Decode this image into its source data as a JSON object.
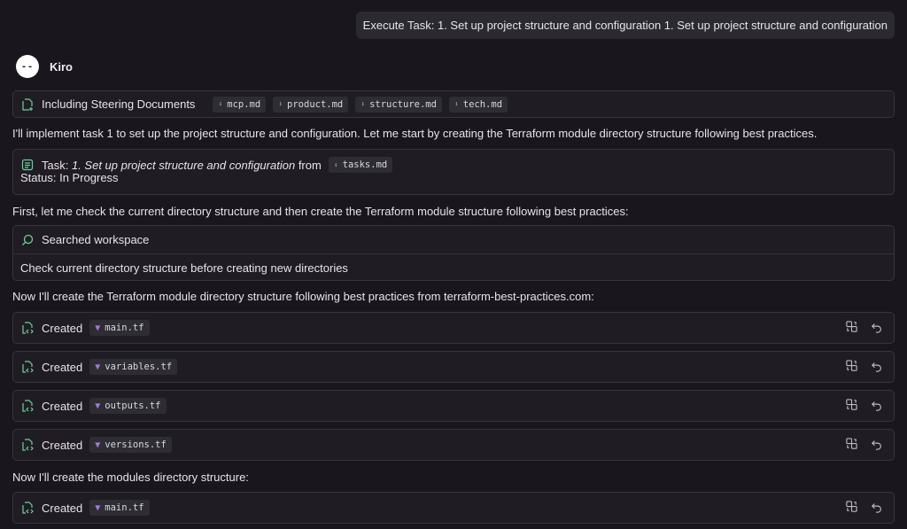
{
  "user_message": "Execute Task: 1. Set up project structure and configuration 1. Set up project structure and configuration",
  "assistant": {
    "avatar_text": "--",
    "name": "Kiro"
  },
  "steering": {
    "label": "Including Steering Documents",
    "docs": [
      "mcp.md",
      "product.md",
      "structure.md",
      "tech.md"
    ]
  },
  "intro_text": "I'll implement task 1 to set up the project structure and configuration. Let me start by creating the Terraform module directory structure following best practices.",
  "task": {
    "prefix": "Task:",
    "name": "1. Set up project structure and configuration",
    "from_label": "from",
    "file": "tasks.md",
    "status": "Status: In Progress"
  },
  "check_text": "First, let me check the current directory structure and then create the Terraform module structure following best practices:",
  "search": {
    "label": "Searched workspace",
    "detail": "Check current directory structure before creating new directories"
  },
  "create_text": "Now I'll create the Terraform module directory structure following best practices from terraform-best-practices.com:",
  "created_label": "Created",
  "created_files": [
    "main.tf",
    "variables.tf",
    "outputs.tf",
    "versions.tf"
  ],
  "modules_text": "Now I'll create the modules directory structure:",
  "modules_files": [
    "main.tf"
  ],
  "colors": {
    "accent_green": "#6fcf97",
    "terraform_purple": "#a47be0",
    "background": "#19171d"
  },
  "icons": {
    "steering": "file-plus-icon",
    "task": "task-list-icon",
    "search": "search-icon",
    "created": "file-code-icon",
    "diff": "compare-icon",
    "revert": "undo-icon"
  }
}
